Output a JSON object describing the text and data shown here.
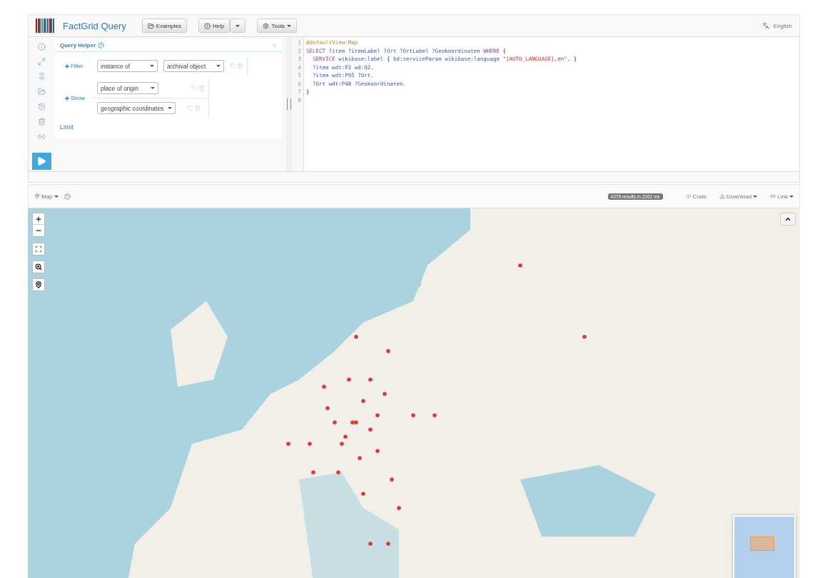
{
  "header": {
    "logo_text": "FactGrid Query",
    "buttons": [
      {
        "label": "Examples",
        "kind": "folder"
      },
      {
        "label": "Help",
        "kind": "help"
      },
      {
        "label": "Tools",
        "kind": "gear"
      }
    ],
    "language": "English"
  },
  "query_helper": {
    "title": "Query Helper",
    "filter": {
      "label": "Filter",
      "property": "instance of",
      "value": "archival object"
    },
    "show": {
      "label": "Show",
      "items": [
        "place of origin",
        "geographic coordinates"
      ]
    },
    "limit": "Limit"
  },
  "editor": {
    "lines": [
      {
        "number": "1",
        "tokens": [
          {
            "text": "#defaultView:Map",
            "kind": "comment"
          }
        ]
      },
      {
        "number": "2",
        "tokens": [
          {
            "text": "SELECT ",
            "kind": "keyword"
          },
          {
            "text": "?item ?itemLabel ?Ort ?OrtLabel ?Geokoordinaten ",
            "kind": "var"
          },
          {
            "text": "WHERE",
            "kind": "keyword"
          },
          {
            "text": " {",
            "kind": "plain"
          }
        ]
      },
      {
        "number": "3",
        "tokens": [
          {
            "text": "  SERVICE ",
            "kind": "keyword"
          },
          {
            "text": "wikibase:label",
            "kind": "var"
          },
          {
            "text": " { ",
            "kind": "plain"
          },
          {
            "text": "bd:serviceParam wikibase:language ",
            "kind": "var"
          },
          {
            "text": "\"[AUTO_LANGUAGE],en\"",
            "kind": "string"
          },
          {
            "text": ". }",
            "kind": "plain"
          }
        ]
      },
      {
        "number": "4",
        "tokens": [
          {
            "text": "  ?item wdt:P2 wd:Q2.",
            "kind": "var"
          }
        ]
      },
      {
        "number": "5",
        "tokens": [
          {
            "text": "  ?item wdt:P95 ?Ort.",
            "kind": "var"
          }
        ]
      },
      {
        "number": "6",
        "tokens": [
          {
            "text": "  ?Ort wdt:P48 ?Geokoordinaten.",
            "kind": "var"
          }
        ]
      },
      {
        "number": "7",
        "tokens": [
          {
            "text": "}",
            "kind": "plain"
          }
        ]
      },
      {
        "number": "8"
      }
    ]
  },
  "results": {
    "view": "Map",
    "count": "4375 results in 2261 ms",
    "actions": [
      {
        "label": "Code",
        "kind": "code",
        "caret": false
      },
      {
        "label": "Download",
        "kind": "download",
        "caret": true
      },
      {
        "label": "Link",
        "kind": "link",
        "caret": true
      }
    ]
  }
}
